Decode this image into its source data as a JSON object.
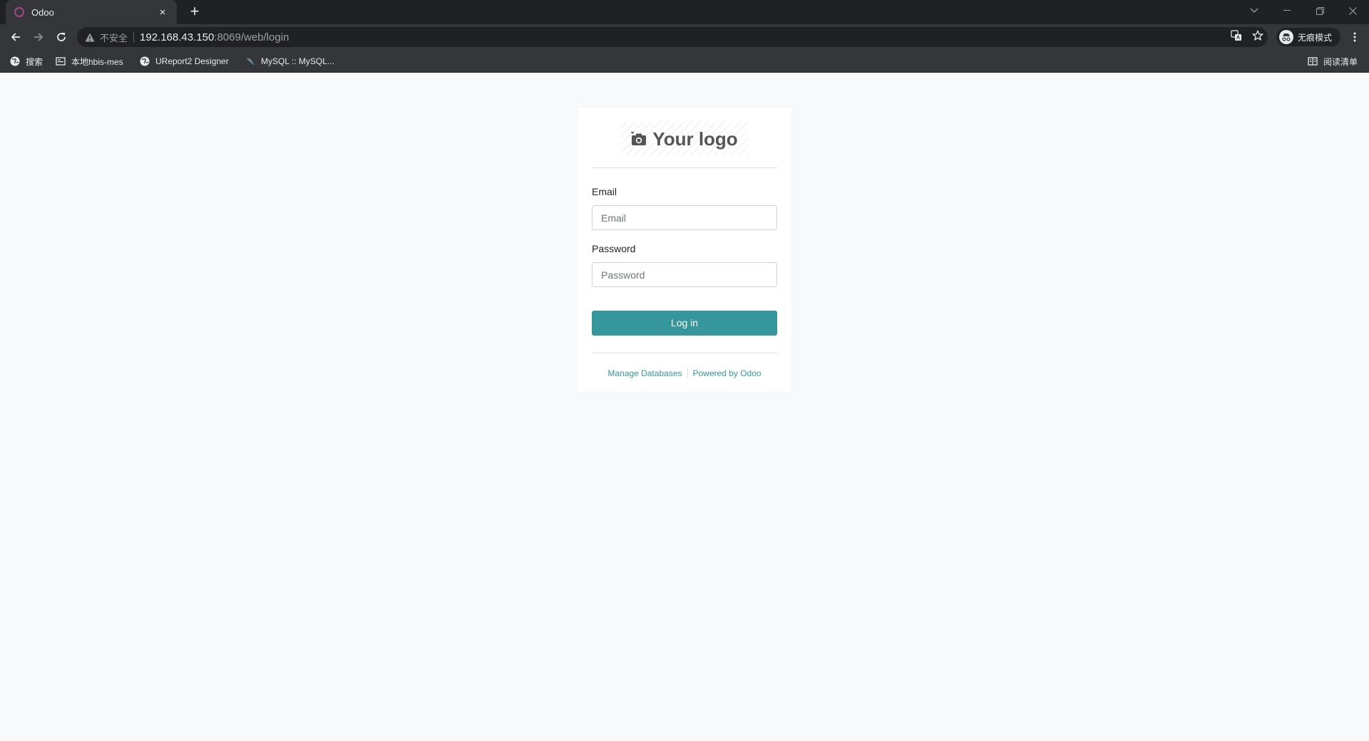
{
  "browser": {
    "tab": {
      "title": "Odoo",
      "close": "×"
    },
    "new_tab": "+",
    "address": {
      "security_label": "不安全",
      "host": "192.168.43.150",
      "path": ":8069/web/login"
    },
    "profile_label": "无痕模式",
    "bookmarks": [
      {
        "label": "搜索",
        "icon": "globe-icon"
      },
      {
        "label": "本地hbis-mes",
        "icon": "bookmark-page-icon"
      },
      {
        "label": "UReport2 Designer",
        "icon": "globe-icon"
      },
      {
        "label": "MySQL :: MySQL...",
        "icon": "mysql-dolphin-icon"
      }
    ],
    "reading_list": "阅读清单"
  },
  "login": {
    "logo_text": "Your logo",
    "email": {
      "label": "Email",
      "placeholder": "Email",
      "value": ""
    },
    "password": {
      "label": "Password",
      "placeholder": "Password",
      "value": ""
    },
    "submit_label": "Log in",
    "footer": {
      "manage_databases": "Manage Databases",
      "powered_by": "Powered by Odoo"
    }
  },
  "colors": {
    "accent": "#35979c",
    "page_background": "#f8f9fa",
    "chrome_dark": "#202124",
    "chrome_toolbar": "#35363a",
    "tab_favicon": "#a24689"
  }
}
